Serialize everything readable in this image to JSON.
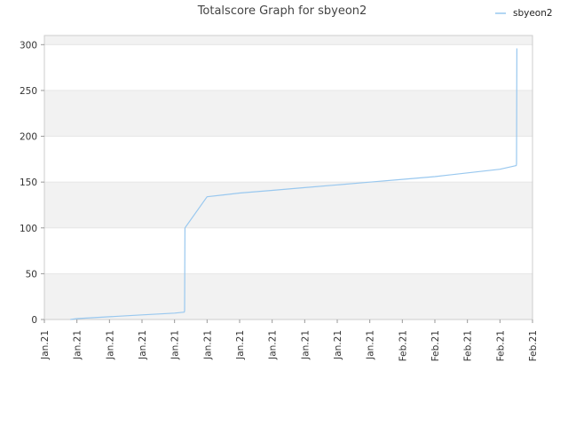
{
  "chart_data": {
    "type": "line",
    "title": "Totalscore Graph for sbyeon2",
    "xlabel": "",
    "ylabel": "",
    "ylim": [
      0,
      310
    ],
    "yticks": [
      0,
      50,
      100,
      150,
      200,
      250,
      300
    ],
    "xtick_labels": [
      "Jan.21",
      "Jan.21",
      "Jan.21",
      "Jan.21",
      "Jan.21",
      "Jan.21",
      "Jan.21",
      "Jan.21",
      "Jan.21",
      "Jan.21",
      "Jan.21",
      "Feb.21",
      "Feb.21",
      "Feb.21",
      "Feb.21",
      "Feb.21"
    ],
    "grid": "horizontal bands",
    "legend_position": "top-right",
    "colors": {
      "series": "#99c8ef",
      "band": "#f2f2f2",
      "axis": "#cccccc"
    },
    "series": [
      {
        "name": "sbyeon2",
        "x": [
          0.8,
          1.0,
          2.0,
          3.0,
          4.0,
          4.3,
          4.31,
          4.32,
          5.0,
          5.5,
          6.0,
          7.0,
          8.0,
          9.0,
          10.0,
          11.0,
          12.0,
          13.0,
          14.0,
          14.5,
          14.51,
          14.52
        ],
        "values": [
          0,
          1,
          3,
          5,
          7,
          8,
          10,
          100,
          134,
          136,
          138,
          141,
          144,
          147,
          150,
          153,
          156,
          160,
          164,
          168,
          170,
          296
        ]
      }
    ]
  }
}
